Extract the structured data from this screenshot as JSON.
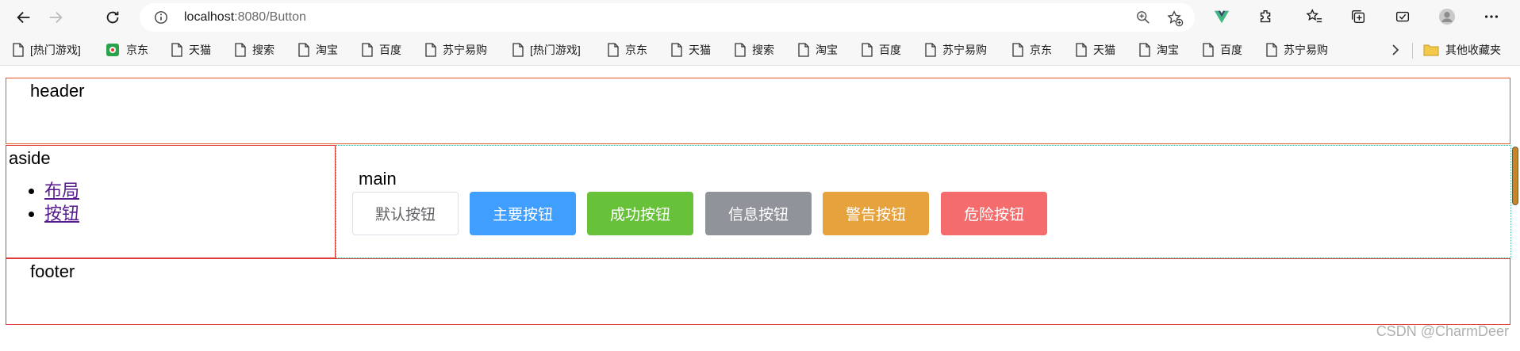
{
  "browser": {
    "url_host": "localhost",
    "url_rest": ":8080/Button",
    "bookmarks": [
      {
        "label": "[热门游戏]",
        "icon": "page-icon"
      },
      {
        "label": "京东",
        "icon": "jd-logo-icon"
      },
      {
        "label": "天猫",
        "icon": "page-icon"
      },
      {
        "label": "搜索",
        "icon": "page-icon"
      },
      {
        "label": "淘宝",
        "icon": "page-icon"
      },
      {
        "label": "百度",
        "icon": "page-icon"
      },
      {
        "label": "苏宁易购",
        "icon": "page-icon"
      },
      {
        "label": "[热门游戏]",
        "icon": "page-icon"
      },
      {
        "label": "京东",
        "icon": "page-icon"
      },
      {
        "label": "天猫",
        "icon": "page-icon"
      },
      {
        "label": "搜索",
        "icon": "page-icon"
      },
      {
        "label": "淘宝",
        "icon": "page-icon"
      },
      {
        "label": "百度",
        "icon": "page-icon"
      },
      {
        "label": "苏宁易购",
        "icon": "page-icon"
      },
      {
        "label": "京东",
        "icon": "page-icon"
      },
      {
        "label": "天猫",
        "icon": "page-icon"
      },
      {
        "label": "淘宝",
        "icon": "page-icon"
      },
      {
        "label": "百度",
        "icon": "page-icon"
      },
      {
        "label": "苏宁易购",
        "icon": "page-icon"
      }
    ],
    "other_favorites": "其他收藏夹"
  },
  "layout": {
    "header": "header",
    "aside": "aside",
    "main": "main",
    "footer": "footer"
  },
  "nav_links": [
    {
      "label": "布局"
    },
    {
      "label": "按钮"
    }
  ],
  "buttons": {
    "default": "默认按钮",
    "primary": "主要按钮",
    "success": "成功按钮",
    "info": "信息按钮",
    "warning": "警告按钮",
    "danger": "危险按钮"
  },
  "colors": {
    "primary": "#409eff",
    "success": "#67c23a",
    "info": "#909399",
    "warning": "#e6a23c",
    "danger": "#f56c6c"
  },
  "watermark": "CSDN @CharmDeer"
}
